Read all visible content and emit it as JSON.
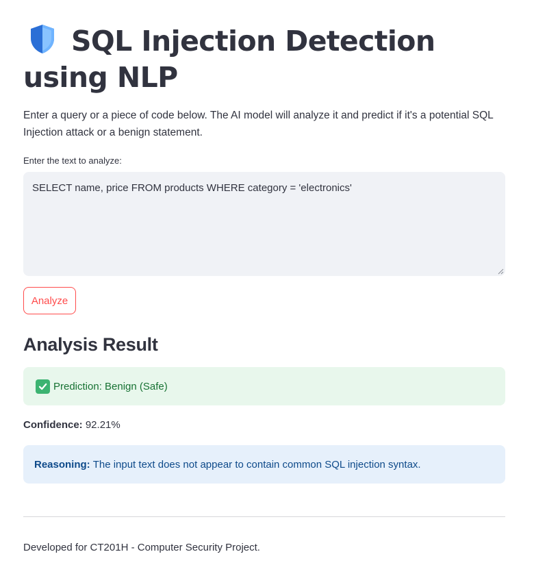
{
  "page": {
    "title": "SQL Injection Detection using NLP",
    "title_icon": "shield-icon",
    "intro": "Enter a query or a piece of code below. The AI model will analyze it and predict if it's a potential SQL Injection attack or a benign statement."
  },
  "input": {
    "label": "Enter the text to analyze:",
    "value": "SELECT name, price FROM products WHERE category = 'electronics'"
  },
  "actions": {
    "analyze_label": "Analyze"
  },
  "result": {
    "heading": "Analysis Result",
    "prediction_icon": "check-mark-icon",
    "prediction_text": "Prediction: Benign (Safe)",
    "confidence_label": "Confidence:",
    "confidence_value": "92.21%",
    "reasoning_label": "Reasoning:",
    "reasoning_text": "The input text does not appear to contain common SQL injection syntax."
  },
  "footer": {
    "text": "Developed for CT201H - Computer Security Project."
  },
  "colors": {
    "accent": "#ff4b4b",
    "success_bg": "#e8f7ec",
    "success_text": "#177233",
    "info_bg": "#e6f0fb",
    "info_text": "#0e4a8a",
    "input_bg": "#f0f2f6"
  }
}
